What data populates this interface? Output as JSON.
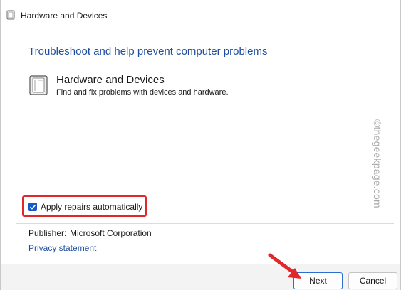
{
  "window": {
    "title": "Hardware and Devices"
  },
  "main": {
    "heading": "Troubleshoot and help prevent computer problems",
    "item": {
      "title": "Hardware and Devices",
      "description": "Find and fix problems with devices and hardware."
    },
    "apply_repairs": {
      "label": "Apply repairs automatically",
      "checked": true
    },
    "publisher": {
      "label": "Publisher:",
      "value": "Microsoft Corporation"
    },
    "privacy_link": "Privacy statement"
  },
  "footer": {
    "next_label": "Next",
    "cancel_label": "Cancel"
  },
  "watermark": "©thegeekpage.com",
  "colors": {
    "heading": "#1f4e9e",
    "link": "#1f4e9e",
    "checkbox": "#1558c9",
    "annotation": "#e0282c"
  },
  "icons": {
    "title": "device-icon",
    "item": "device-icon",
    "arrow": "annotation-arrow-icon"
  }
}
